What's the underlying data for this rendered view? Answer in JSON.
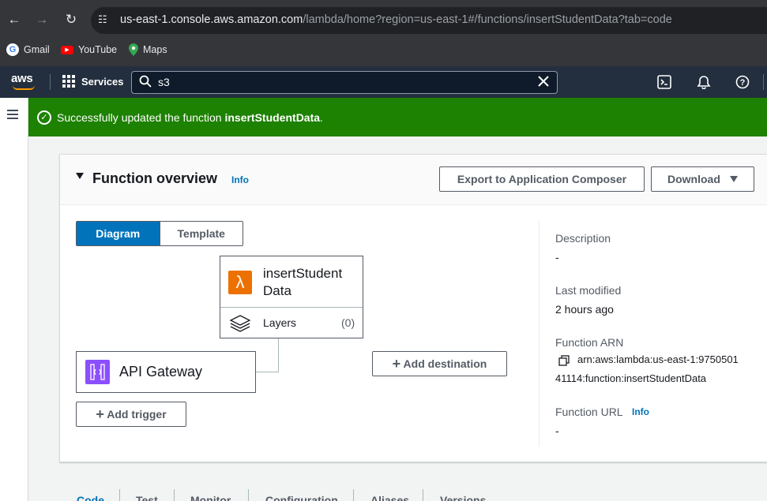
{
  "browser": {
    "url_host": "us-east-1.console.aws.amazon.com",
    "url_path": "/lambda/home?region=us-east-1#/functions/insertStudentData?tab=code",
    "bookmarks": [
      {
        "label": "Gmail",
        "icon": "gmail-icon"
      },
      {
        "label": "YouTube",
        "icon": "youtube-icon"
      },
      {
        "label": "Maps",
        "icon": "maps-icon"
      }
    ]
  },
  "nav": {
    "logo": "aws",
    "services_label": "Services",
    "search_value": "s3"
  },
  "flash": {
    "message_prefix": "Successfully updated the function ",
    "function_name": "insertStudentData",
    "message_suffix": "."
  },
  "overview": {
    "title": "Function overview",
    "info": "Info",
    "export_button": "Export to Application Composer",
    "download_button": "Download",
    "seg_diagram": "Diagram",
    "seg_template": "Template",
    "function_name": "insertStudentData",
    "layers_label": "Layers",
    "layers_count": "(0)",
    "trigger_name": "API Gateway",
    "add_trigger": "Add trigger",
    "add_destination": "Add destination",
    "description_label": "Description",
    "description_value": "-",
    "last_modified_label": "Last modified",
    "last_modified_value": "2 hours ago",
    "arn_label": "Function ARN",
    "arn_line1": "arn:aws:lambda:us-east-1:9750501",
    "arn_line2": "41114:function:insertStudentData",
    "url_label": "Function URL",
    "url_info": "Info",
    "url_value": "-"
  },
  "tabs": [
    "Code",
    "Test",
    "Monitor",
    "Configuration",
    "Aliases",
    "Versions"
  ],
  "colors": {
    "flash_green": "#1d8102",
    "aws_nav": "#232f3e",
    "primary_blue": "#0073bb",
    "lambda_orange": "#ed7100",
    "apigw_purple": "#8c4fff"
  }
}
